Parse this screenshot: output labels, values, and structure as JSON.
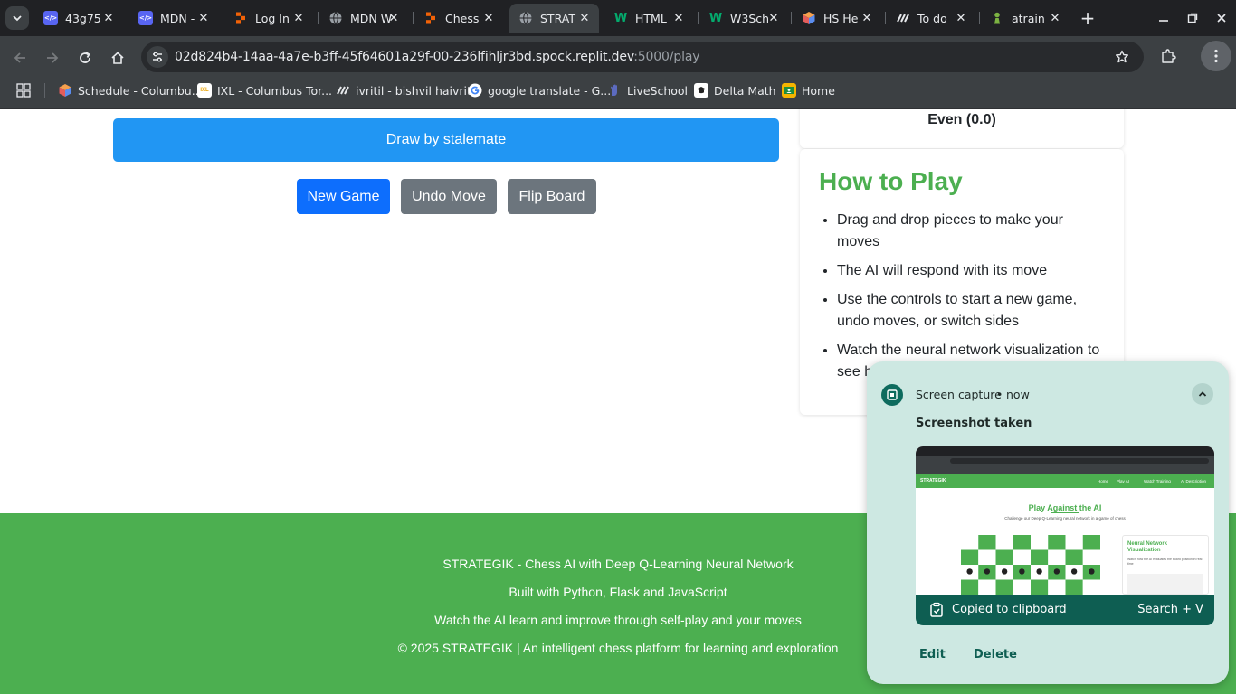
{
  "browser": {
    "tabs": [
      {
        "title": "43g75",
        "favicon": "code-icon",
        "color": "#5865f2",
        "active": false
      },
      {
        "title": "MDN -",
        "favicon": "code-icon",
        "color": "#5865f2",
        "active": false
      },
      {
        "title": "Log In",
        "favicon": "replit-icon",
        "color": "#f26207",
        "active": false
      },
      {
        "title": "MDN W",
        "favicon": "globe-icon",
        "color": "#9aa0a6",
        "active": false
      },
      {
        "title": "Chess",
        "favicon": "replit-icon",
        "color": "#f26207",
        "active": false
      },
      {
        "title": "STRAT",
        "favicon": "globe-icon",
        "color": "#9aa0a6",
        "active": true
      },
      {
        "title": "HTML",
        "favicon": "w3schools-icon",
        "color": "#04aa6d",
        "active": false
      },
      {
        "title": "W3Sch",
        "favicon": "w3schools-icon",
        "color": "#04aa6d",
        "active": false
      },
      {
        "title": "HS He",
        "favicon": "cube-icon",
        "color": "#e8773a",
        "active": false
      },
      {
        "title": "To do",
        "favicon": "stripes-icon",
        "color": "#1a73e8",
        "active": false
      },
      {
        "title": "atrain",
        "favicon": "pawn-icon",
        "color": "#7cb342",
        "active": false
      }
    ],
    "url_host": "02d824b4-14aa-4a7e-b3ff-45f64601a29f-00-236lfihljr3bd.spock.replit.dev",
    "url_path": ":5000/play",
    "bookmarks": [
      {
        "label": "Schedule - Columbu...",
        "icon": "cube-icon",
        "color": "#e8773a"
      },
      {
        "label": "IXL - Columbus Tor...",
        "icon": "ixl-icon",
        "color": "#f5c518"
      },
      {
        "label": "ivritil - bishvil haivrit",
        "icon": "stripes-icon",
        "color": "#1a73e8"
      },
      {
        "label": "google translate - G...",
        "icon": "google-icon",
        "color": "#ffffff"
      },
      {
        "label": "LiveSchool",
        "icon": "hand-icon",
        "color": "#3f51b5"
      },
      {
        "label": "Delta Math",
        "icon": "grad-cap-icon",
        "color": "#ffffff"
      },
      {
        "label": "Home",
        "icon": "classroom-icon",
        "color": "#f5b400"
      }
    ]
  },
  "game": {
    "status": "Draw by stalemate",
    "buttons": {
      "new_game": "New Game",
      "undo": "Undo Move",
      "flip": "Flip Board"
    },
    "evaluation": "Even (0.0)"
  },
  "how_to_play": {
    "title": "How to Play",
    "items": [
      "Drag and drop pieces to make your moves",
      "The AI will respond with its move",
      "Use the controls to start a new game, undo moves, or switch sides",
      "Watch the neural network visualization to see how the AI evaluates the board"
    ]
  },
  "footer": {
    "line1": "STRATEGIK - Chess AI with Deep Q-Learning Neural Network",
    "line2": "Built with Python, Flask and JavaScript",
    "line3": "Watch the AI learn and improve through self-play and your moves",
    "line4": "© 2025 STRATEGIK | An intelligent chess platform for learning and exploration"
  },
  "notification": {
    "app": "Screen capture",
    "separator": "•",
    "time": "now",
    "message": "Screenshot taken",
    "clipboard_label": "Copied to clipboard",
    "shortcut": "Search + V",
    "edit": "Edit",
    "delete": "Delete",
    "thumbnail": {
      "brand": "STRATEGIK",
      "nav": [
        "Home",
        "Play AI",
        "Watch Training",
        "AI Description"
      ],
      "title": "Play Against the AI",
      "subtitle": "Challenge our Deep Q-Learning neural network in a game of chess",
      "panel_title": "Neural Network Visualization",
      "panel_text": "Watch how the AI evaluates the board position in real time"
    }
  },
  "colors": {
    "accent_green": "#4caf50",
    "status_blue": "#2196f3",
    "primary_blue": "#0d6efd",
    "secondary_gray": "#6c757d"
  }
}
